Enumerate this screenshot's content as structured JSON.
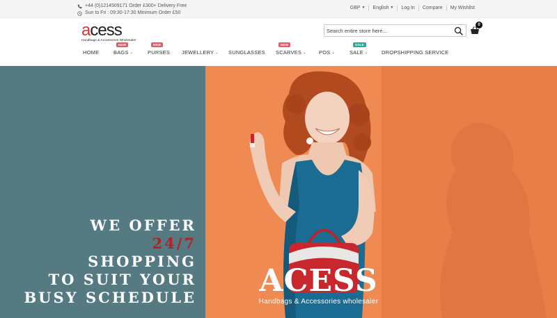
{
  "topbar": {
    "phone_text": "+44 (0)1214509171 Order £300+ Delivery Free",
    "hours_text": "Sun to Fri : 09:30-17:30 Minimum Order £50",
    "currency": "GBP",
    "language": "English",
    "login": "Log In",
    "compare": "Compare",
    "wishlist": "My Wishlist"
  },
  "header": {
    "logo_word_accent": "a",
    "logo_word_rest": "cess",
    "logo_tagline": "Handbags & Accessories Wholesaler",
    "search_placeholder": "Search entire store here...",
    "cart_count": "0"
  },
  "nav": {
    "items": [
      {
        "label": "HOME",
        "badge": ""
      },
      {
        "label": "BAGS",
        "badge": "NEW",
        "dropdown": true
      },
      {
        "label": "PURSES",
        "badge": "NEW"
      },
      {
        "label": "JEWELLERY",
        "badge": "",
        "dropdown": true
      },
      {
        "label": "SUNGLASSES",
        "badge": ""
      },
      {
        "label": "SCARVES",
        "badge": "NEW",
        "dropdown": true
      },
      {
        "label": "POS",
        "badge": "",
        "dropdown": true
      },
      {
        "label": "SALE",
        "badge": "SALE",
        "dropdown": true
      },
      {
        "label": "DROPSHIPPING SERVICE",
        "badge": ""
      }
    ]
  },
  "hero": {
    "slogan_line1": "WE OFFER",
    "slogan_line2": "24/7",
    "slogan_line3": "SHOPPING",
    "slogan_line4": "TO SUIT YOUR",
    "slogan_line5": "BUSY SCHEDULE",
    "brand_title": "ACESS",
    "brand_subtitle": "Handbags & Accessories wholesaler"
  },
  "colors": {
    "hero_left_bg": "#567a82",
    "hero_right_bg": "#ee8a52",
    "accent_red": "#b42025",
    "badge_new": "#e45b6a",
    "badge_sale": "#2aa89a"
  },
  "icons": [
    "phone-icon",
    "clock-icon",
    "search-icon",
    "cart-icon",
    "chevron-down-icon"
  ]
}
